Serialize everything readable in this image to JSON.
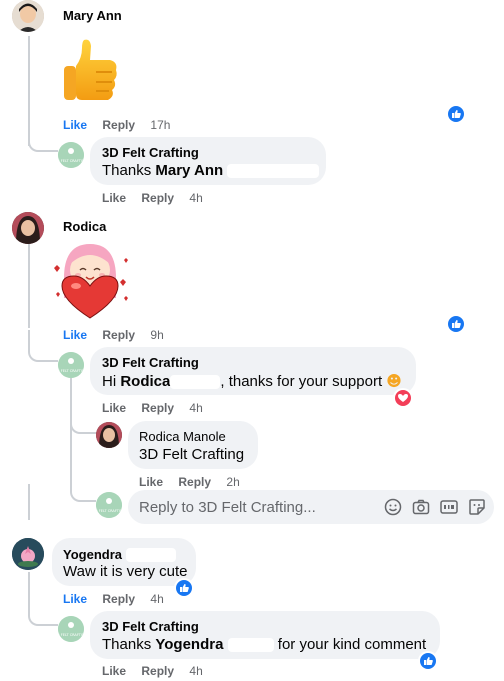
{
  "comments": [
    {
      "author": "Mary Ann",
      "time": "17h",
      "like_label": "Like",
      "reply_label": "Reply",
      "sticker": "thumbs-up-sticker"
    },
    {
      "author": "Rodica",
      "time": "9h",
      "like_label": "Like",
      "reply_label": "Reply",
      "sticker": "girl-heart-sticker"
    },
    {
      "author": "Yogendra",
      "text": "Waw it is very cute",
      "time": "4h",
      "like_label": "Like",
      "reply_label": "Reply"
    }
  ],
  "replies": [
    {
      "author": "3D Felt Crafting",
      "text_prefix": "Thanks",
      "mention": "Mary Ann",
      "text_suffix": "",
      "time": "4h",
      "like_label": "Like",
      "reply_label": "Reply"
    },
    {
      "author": "3D Felt Crafting",
      "text_prefix": "Hi",
      "mention": "Rodica",
      "text_suffix": ", thanks for your support",
      "time": "4h",
      "like_label": "Like",
      "reply_label": "Reply"
    },
    {
      "author": "Rodica Manole",
      "mention": "3D Felt Crafting",
      "time": "2h",
      "like_label": "Like",
      "reply_label": "Reply"
    },
    {
      "author": "3D Felt Crafting",
      "text_prefix": "Thanks",
      "mention": "Yogendra",
      "text_suffix": "for your kind comment",
      "time": "4h",
      "like_label": "Like",
      "reply_label": "Reply"
    }
  ],
  "reply_box": {
    "placeholder": "Reply to 3D Felt Crafting..."
  },
  "page_logo_text": "3D FELT CRAFTING",
  "colors": {
    "like_blue": "#1877f2",
    "bubble_bg": "#f0f2f5",
    "meta_gray": "#65676b",
    "love_red": "#f33e58"
  }
}
